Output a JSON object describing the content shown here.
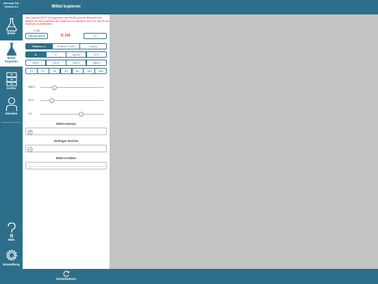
{
  "app": {
    "name": "Remedy Pro",
    "version": "Version 3.4"
  },
  "sidebar": {
    "items": [
      {
        "label": "Mittel"
      },
      {
        "label": "Mittel kopieren"
      },
      {
        "label": "Archiv"
      },
      {
        "label": "Klienten"
      },
      {
        "label": "Hilfe"
      },
      {
        "label": "Einstellung"
      }
    ]
  },
  "panel": {
    "title": "Mittel kopieren",
    "warning": "Das Gerät ist NICHT im Flugmodus oder WLAN und/oder Bluetooth sind aktiviert. Es wird empfohlen den Flugmodus zu aktivieren und/ oder WLAN und Bluetooth zu deaktivieren.",
    "count_label": "0.196",
    "standard_label": "Standardwert",
    "dose": "D 216",
    "check_label": "☑",
    "mode_segments": [
      "Potenz x 1",
      "Potenz x 1000",
      "Copan"
    ],
    "mode_selected": 0,
    "potency_segments": [
      "D",
      "C",
      "Q(LM)",
      "M K"
    ],
    "potency_selected": 0,
    "korsakov_segments": [
      "XM K",
      "LM K",
      "CM K",
      "MM K"
    ],
    "value_segments": [
      "10",
      "12",
      "15",
      "30",
      "60",
      "100",
      "200"
    ],
    "sliders": [
      {
        "label": "100 x",
        "value": 0.22
      },
      {
        "label": "10 x",
        "value": 0.18
      },
      {
        "label": "1 x",
        "value": 0.65
      }
    ],
    "sections": [
      {
        "title": "Mittel einlesen",
        "icon": "fingerprint-icon"
      },
      {
        "title": "Zielträger löschen",
        "icon": "erase-icon"
      },
      {
        "title": "Mittel erstellen",
        "icon": "create-icon"
      }
    ],
    "reset_label": "Zurücksetzen"
  },
  "colors": {
    "primary": "#2d6f8a",
    "alert": "#e8232f",
    "background": "#c3c3c3"
  }
}
